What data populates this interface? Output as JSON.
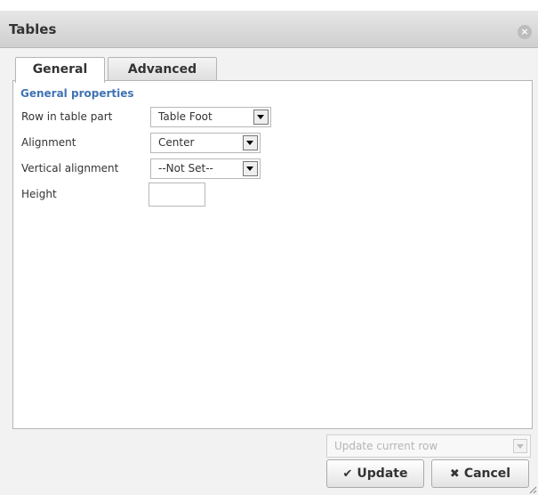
{
  "dialog": {
    "title": "Tables",
    "close_icon": "close-icon"
  },
  "tabs": [
    {
      "label": "General",
      "active": true
    },
    {
      "label": "Advanced",
      "active": false
    }
  ],
  "general": {
    "section_label": "General properties",
    "row_in_table_part": {
      "label": "Row in table part",
      "value": "Table Foot"
    },
    "alignment": {
      "label": "Alignment",
      "value": "Center"
    },
    "vertical_alignment": {
      "label": "Vertical alignment",
      "value": "--Not Set--"
    },
    "height": {
      "label": "Height",
      "value": ""
    }
  },
  "footer": {
    "scope_select": {
      "value": "Update current row"
    },
    "update_label": "Update",
    "cancel_label": "Cancel",
    "update_icon": "check-icon",
    "cancel_icon": "x-icon"
  },
  "colors": {
    "section_label": "#3f73b3"
  }
}
